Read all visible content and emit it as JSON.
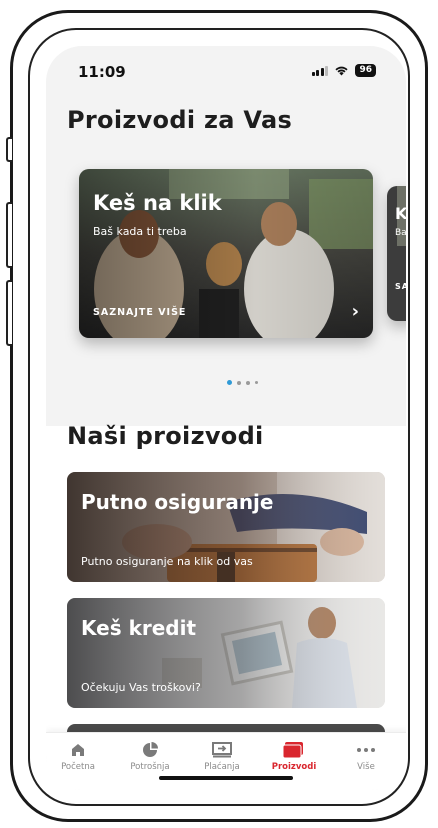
{
  "status_bar": {
    "time": "11:09",
    "battery": "96"
  },
  "for_you": {
    "title": "Proizvodi za Vas",
    "cards": [
      {
        "title": "Keš na klik",
        "subtitle": "Baš kada ti treba",
        "cta": "SAZNAJTE VIŠE",
        "arrow": "›"
      },
      {
        "title": "K",
        "subtitle": "Ba",
        "cta": "SAZ"
      }
    ],
    "carousel_pages": 4,
    "active_page": 1
  },
  "products": {
    "title": "Naši proizvodi",
    "items": [
      {
        "title": "Putno osiguranje",
        "subtitle": "Putno osiguranje na klik od vas"
      },
      {
        "title": "Keš kredit",
        "subtitle": "Očekuju Vas troškovi?"
      }
    ]
  },
  "tab_bar": {
    "tabs": [
      {
        "label": "Početna",
        "icon": "home-icon"
      },
      {
        "label": "Potrošnja",
        "icon": "pie-chart-icon"
      },
      {
        "label": "Plaćanja",
        "icon": "transfer-icon"
      },
      {
        "label": "Proizvodi",
        "icon": "card-icon"
      },
      {
        "label": "Više",
        "icon": "more-icon"
      }
    ],
    "active": "Proizvodi"
  },
  "colors": {
    "accent": "#d9262e",
    "dot_active": "#2f9ad6",
    "background_top": "#f3f3f3"
  }
}
